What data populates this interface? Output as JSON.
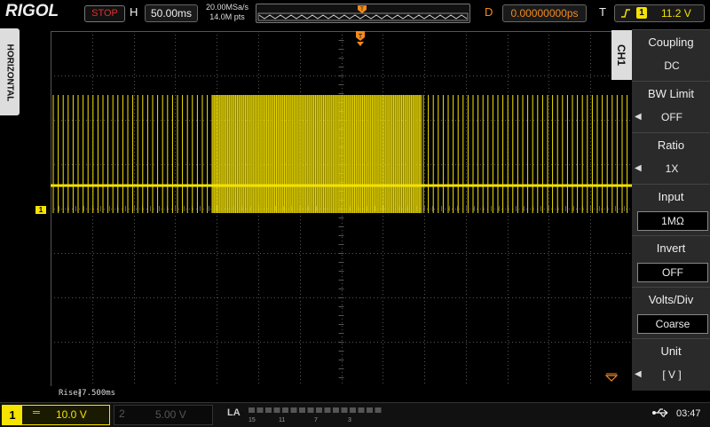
{
  "top": {
    "brand": "RIGOL",
    "run_status": "STOP",
    "h_label": "H",
    "timebase": "50.00ms",
    "sample_rate": "20.00MSa/s",
    "memory_depth": "14.0M pts",
    "d_label": "D",
    "delay": "0.00000000ps",
    "t_label": "T",
    "trigger_icon": "rising-edge-icon",
    "trigger_source": "1",
    "trigger_level": "11.2 V"
  },
  "left_tab": {
    "label": "HORIZONTAL"
  },
  "channel_marker": "1",
  "menu": {
    "tab_label": "CH1",
    "items": [
      {
        "title": "Coupling",
        "value": "DC"
      },
      {
        "title": "BW Limit",
        "value": "OFF"
      },
      {
        "title": "Ratio",
        "value": "1X"
      },
      {
        "title": "Input",
        "value": "1MΩ"
      },
      {
        "title": "Invert",
        "value": "OFF"
      },
      {
        "title": "Volts/Div",
        "value": "Coarse"
      },
      {
        "title": "Unit",
        "value": "[ V ]"
      }
    ]
  },
  "measurement": "Rise∦7.500ms",
  "bottom": {
    "ch1_number": "1",
    "ch1_coupling": "═",
    "ch1_scale": "10.0 V",
    "ch2_number": "2",
    "ch2_scale": "5.00 V",
    "la_label": "LA",
    "la_numbers": [
      "15",
      "11",
      "7",
      "3"
    ],
    "usb_icon": "usb-icon",
    "time": "03:47"
  },
  "colors": {
    "ch1": "#f5e300",
    "trigger": "#f28a1e",
    "stop": "#e03030",
    "grid": "#555555"
  }
}
